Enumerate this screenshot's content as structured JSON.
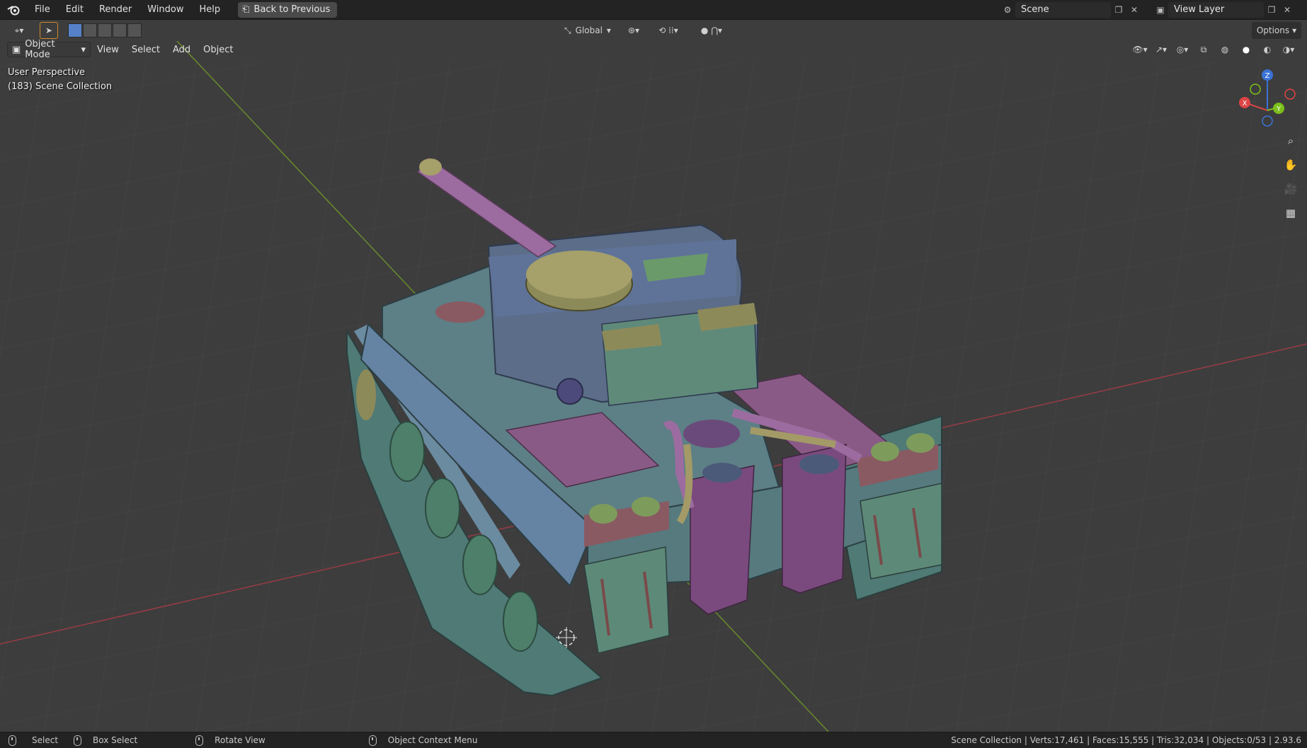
{
  "menu": {
    "file": "File",
    "edit": "Edit",
    "render": "Render",
    "window": "Window",
    "help": "Help",
    "back": "Back to Previous"
  },
  "scene": {
    "scene_name": "Scene",
    "view_layer": "View Layer"
  },
  "header": {
    "orientation": "Global",
    "options": "Options"
  },
  "viewport_menu": {
    "mode": "Object Mode",
    "view": "View",
    "select": "Select",
    "add": "Add",
    "object": "Object"
  },
  "overlay": {
    "perspective": "User Perspective",
    "collection": "(183) Scene Collection"
  },
  "gizmo": {
    "z": "Z",
    "y": "Y",
    "x": "X"
  },
  "status": {
    "select": "Select",
    "box_select": "Box Select",
    "rotate": "Rotate View",
    "context": "Object Context Menu",
    "stats": "Scene Collection | Verts:17,461 | Faces:15,555 | Tris:32,034 | Objects:0/53 | 2.93.6"
  },
  "colors": {
    "grid_bg": "#3d3d3d",
    "x_axis": "#9a3b46",
    "y_axis": "#6a8a2c",
    "hull_blue": "#5d7a8a",
    "turret_blue": "#5b6d88",
    "magenta": "#8a5a86",
    "olive": "#8d8a5a",
    "green": "#5e8a78"
  },
  "icons": [
    "blender-logo-icon",
    "back-icon",
    "editor-type-icon",
    "cursor-icon",
    "pivot-icon",
    "snap-icon",
    "proportional-icon",
    "visibility-icon",
    "gizmo-icon",
    "overlay-icon",
    "xray-icon",
    "shading-wire-icon",
    "shading-solid-icon",
    "shading-material-icon",
    "shading-render-icon",
    "zoom-icon",
    "hand-icon",
    "camera-icon",
    "grid-icon",
    "mouse-left-icon",
    "mouse-middle-icon",
    "mouse-right-icon"
  ]
}
